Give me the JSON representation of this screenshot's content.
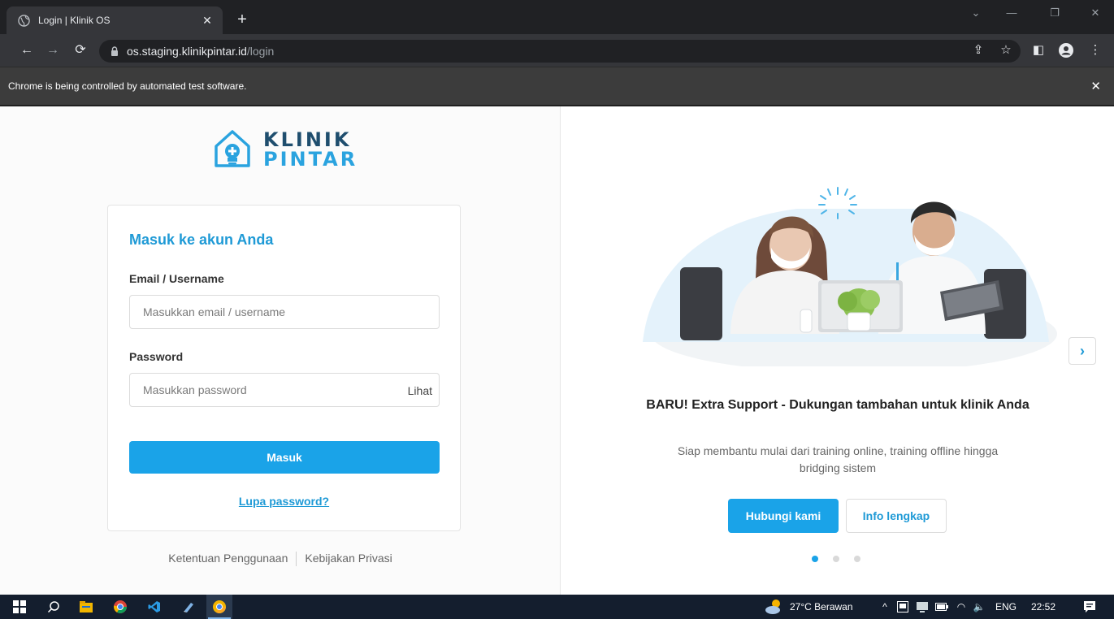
{
  "browser": {
    "tab": {
      "title": "Login | Klinik OS",
      "favicon": "globe-icon"
    },
    "address": {
      "host": "os.staging.klinikpintar.id",
      "path": "/login"
    },
    "infobar": {
      "message": "Chrome is being controlled by automated test software."
    }
  },
  "page": {
    "logo": {
      "line1": "KLINIK",
      "line2": "PINTAR",
      "brand_dark": "#1f4e6e",
      "brand_light": "#2aa3df"
    },
    "login_form": {
      "title": "Masuk ke akun Anda",
      "email_label": "Email / Username",
      "email_placeholder": "Masukkan email / username",
      "password_label": "Password",
      "password_placeholder": "Masukkan password",
      "show_password": "Lihat",
      "submit": "Masuk",
      "forgot": "Lupa password?"
    },
    "footer": {
      "terms": "Ketentuan Penggunaan",
      "privacy": "Kebijakan Privasi"
    },
    "promo": {
      "title": "BARU! Extra Support - Dukungan tambahan untuk klinik Anda",
      "description": "Siap membantu mulai dari training online, training offline hingga bridging sistem",
      "contact_button": "Hubungi kami",
      "info_button": "Info lengkap",
      "slides_total": 3,
      "active_slide": 1
    },
    "accent": "#1aa3e8"
  },
  "taskbar": {
    "weather": "27°C  Berawan",
    "language": "ENG",
    "time": "22:52"
  }
}
